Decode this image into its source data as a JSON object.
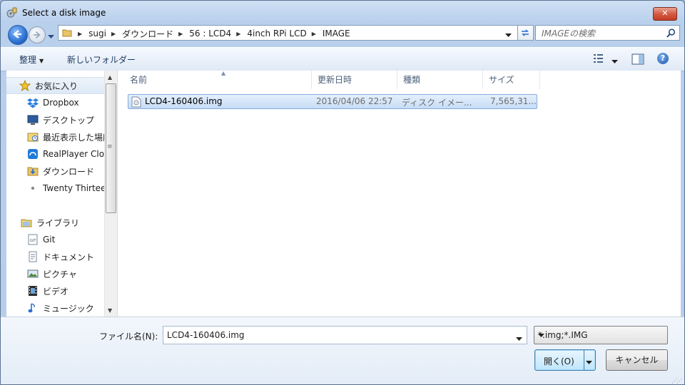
{
  "window": {
    "title": "Select a disk image",
    "close_glyph": "✕"
  },
  "nav": {
    "breadcrumbs": [
      "sugi",
      "ダウンロード",
      "56 : LCD4",
      "4inch RPi LCD",
      "IMAGE"
    ],
    "search_placeholder": "IMAGEの検索"
  },
  "toolbar": {
    "organize_label": "整理",
    "new_folder_label": "新しいフォルダー",
    "help_glyph": "?"
  },
  "sidebar": {
    "favorites_label": "お気に入り",
    "favorites": [
      {
        "label": "Dropbox",
        "icon": "dropbox-icon"
      },
      {
        "label": "デスクトップ",
        "icon": "desktop-icon"
      },
      {
        "label": "最近表示した場所",
        "icon": "recent-places-icon"
      },
      {
        "label": "RealPlayer Cloud",
        "icon": "realplayer-cloud-icon"
      },
      {
        "label": "ダウンロード",
        "icon": "downloads-folder-icon"
      },
      {
        "label": "Twenty Thirteen",
        "icon": "small-item-icon"
      }
    ],
    "libraries_label": "ライブラリ",
    "libraries": [
      {
        "label": "Git",
        "icon": "git-library-icon"
      },
      {
        "label": "ドキュメント",
        "icon": "documents-icon"
      },
      {
        "label": "ピクチャ",
        "icon": "pictures-icon"
      },
      {
        "label": "ビデオ",
        "icon": "video-icon"
      },
      {
        "label": "ミュージック",
        "icon": "music-icon"
      }
    ]
  },
  "file_list": {
    "columns": [
      "名前",
      "更新日時",
      "種類",
      "サイズ"
    ],
    "rows": [
      {
        "name": "LCD4-160406.img",
        "modified": "2016/04/06 22:57",
        "type": "ディスク イメー...",
        "size": "7,565,31..."
      }
    ]
  },
  "footer": {
    "filename_label": "ファイル名(N):",
    "filename_value": "LCD4-160406.img",
    "filetype_value": "*.img;*.IMG",
    "open_label": "開く(O)",
    "cancel_label": "キャンセル"
  },
  "colors": {
    "selection": "#c6dcf7",
    "accent": "#3c7fb1",
    "close": "#c23d22"
  }
}
